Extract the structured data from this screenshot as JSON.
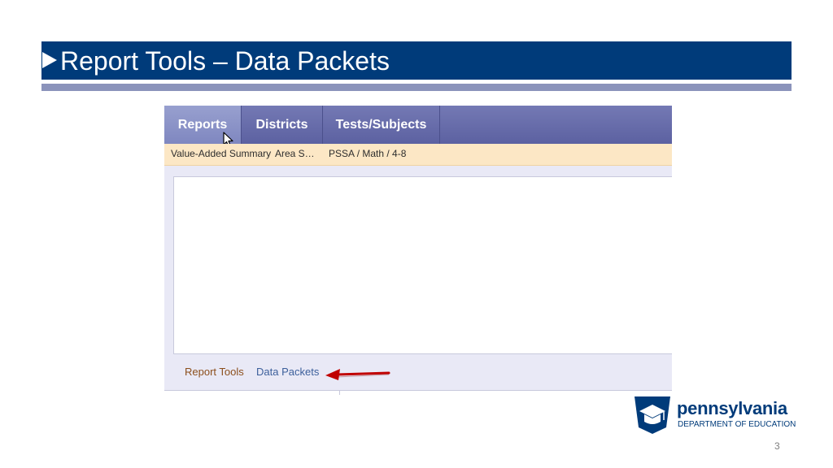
{
  "slide": {
    "title": "Report Tools – Data Packets",
    "page_number": "3"
  },
  "screenshot": {
    "nav_tabs": [
      {
        "label": "Reports",
        "active": true
      },
      {
        "label": "Districts",
        "active": false
      },
      {
        "label": "Tests/Subjects",
        "active": false
      }
    ],
    "breadcrumbs": [
      "Value-Added Summary",
      "Area S…",
      "PSSA / Math / 4-8"
    ],
    "tools": {
      "section_label": "Report Tools",
      "link_label": "Data Packets"
    }
  },
  "logo": {
    "name": "pennsylvania",
    "department": "DEPARTMENT OF EDUCATION"
  },
  "colors": {
    "title_bar": "#003b7a",
    "nav_bar": "#5c61a1",
    "breadcrumb_bg": "#fce7c5",
    "pointer_arrow": "#c00000"
  },
  "icons": {
    "title_bullet": "triangle-right-icon",
    "cursor": "mouse-pointer-icon",
    "annotation": "red-arrow-icon",
    "logo_mark": "keystone-logo-icon"
  }
}
